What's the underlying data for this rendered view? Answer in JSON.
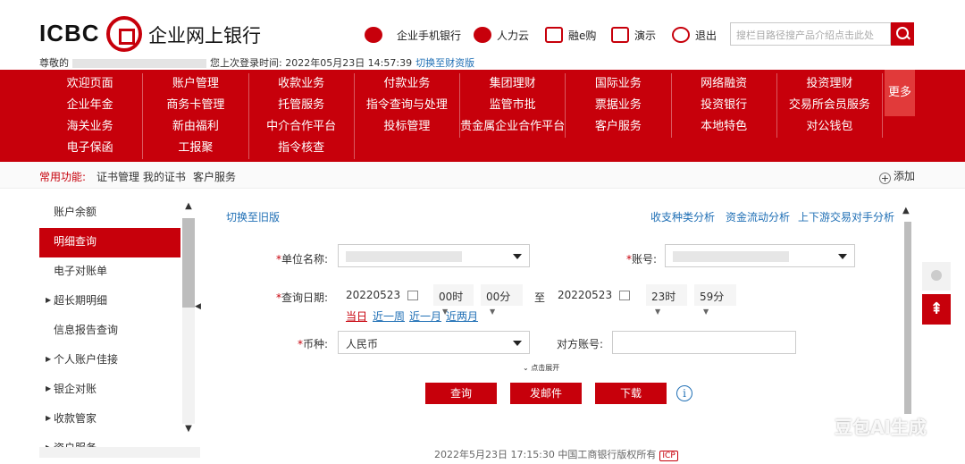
{
  "brand": {
    "en": "ICBC",
    "cn": "企业网上银行"
  },
  "topnav": [
    {
      "label": "企业手机银行",
      "icon": "mobile-bank-icon"
    },
    {
      "label": "人力云",
      "icon": "cloud-icon"
    },
    {
      "label": "融e购",
      "icon": "cart-icon"
    },
    {
      "label": "演示",
      "icon": "demo-icon"
    },
    {
      "label": "退出",
      "icon": "power-icon"
    }
  ],
  "search": {
    "placeholder": "搜栏目路径搜产品介绍点击此处"
  },
  "welcome": {
    "prefix": "尊敬的",
    "last_login": "您上次登录时间: 2022年05月23日 14:57:39",
    "switch_link": "切换至财资版"
  },
  "menu": {
    "items": [
      "欢迎页面",
      "账户管理",
      "收款业务",
      "付款业务",
      "集团理财",
      "国际业务",
      "网络融资",
      "投资理财",
      "企业年金",
      "商务卡管理",
      "托管服务",
      "指令查询与处理",
      "监管市批",
      "票据业务",
      "投资银行",
      "交易所会员服务",
      "海关业务",
      "新由福利",
      "中介合作平台",
      "投标管理",
      "贵金属企业合作平台",
      "客户服务",
      "本地特色",
      "对公钱包",
      "电子保函",
      "工报聚",
      "指令核查"
    ],
    "more": "更多"
  },
  "common": {
    "label": "常用功能:",
    "items": [
      "证书管理 我的证书",
      "客户服务"
    ],
    "add": "添加"
  },
  "sidebar": {
    "items": [
      {
        "label": "账户余额",
        "arrow": false,
        "active": false
      },
      {
        "label": "明细查询",
        "arrow": false,
        "active": true
      },
      {
        "label": "电子对账单",
        "arrow": false,
        "active": false
      },
      {
        "label": "超长期明细",
        "arrow": true,
        "active": false
      },
      {
        "label": "信息报告查询",
        "arrow": false,
        "active": false
      },
      {
        "label": "个人账户佳接",
        "arrow": true,
        "active": false
      },
      {
        "label": "银企对账",
        "arrow": true,
        "active": false
      },
      {
        "label": "收款管家",
        "arrow": true,
        "active": false
      },
      {
        "label": "资户服务",
        "arrow": true,
        "active": false
      }
    ]
  },
  "main": {
    "switch_old": "切换至旧版",
    "analysis_links": [
      "收支种类分析",
      "资金流动分析",
      "上下游交易对手分析"
    ],
    "unit_label": "单位名称:",
    "account_label": "账号:",
    "date_label": "查询日期:",
    "from_date": "20220523",
    "from_hour": "00时",
    "from_min": "00分",
    "to_word": "至",
    "to_date": "20220523",
    "to_hour": "23时",
    "to_min": "59分",
    "quick": [
      "当日",
      "近一周",
      "近一月",
      "近两月"
    ],
    "currency_label": "币种:",
    "currency_value": "人民币",
    "counter_label": "对方账号:",
    "expand": "点击展开",
    "buttons": [
      "查询",
      "发邮件",
      "下载"
    ]
  },
  "footer": {
    "text": "2022年5月23日 17:15:30   中国工商银行版权所有",
    "badge": "ICP"
  },
  "watermark": "豆包AI生成",
  "colors": {
    "brand_red": "#c7000b",
    "link_blue": "#1f6fb5"
  }
}
